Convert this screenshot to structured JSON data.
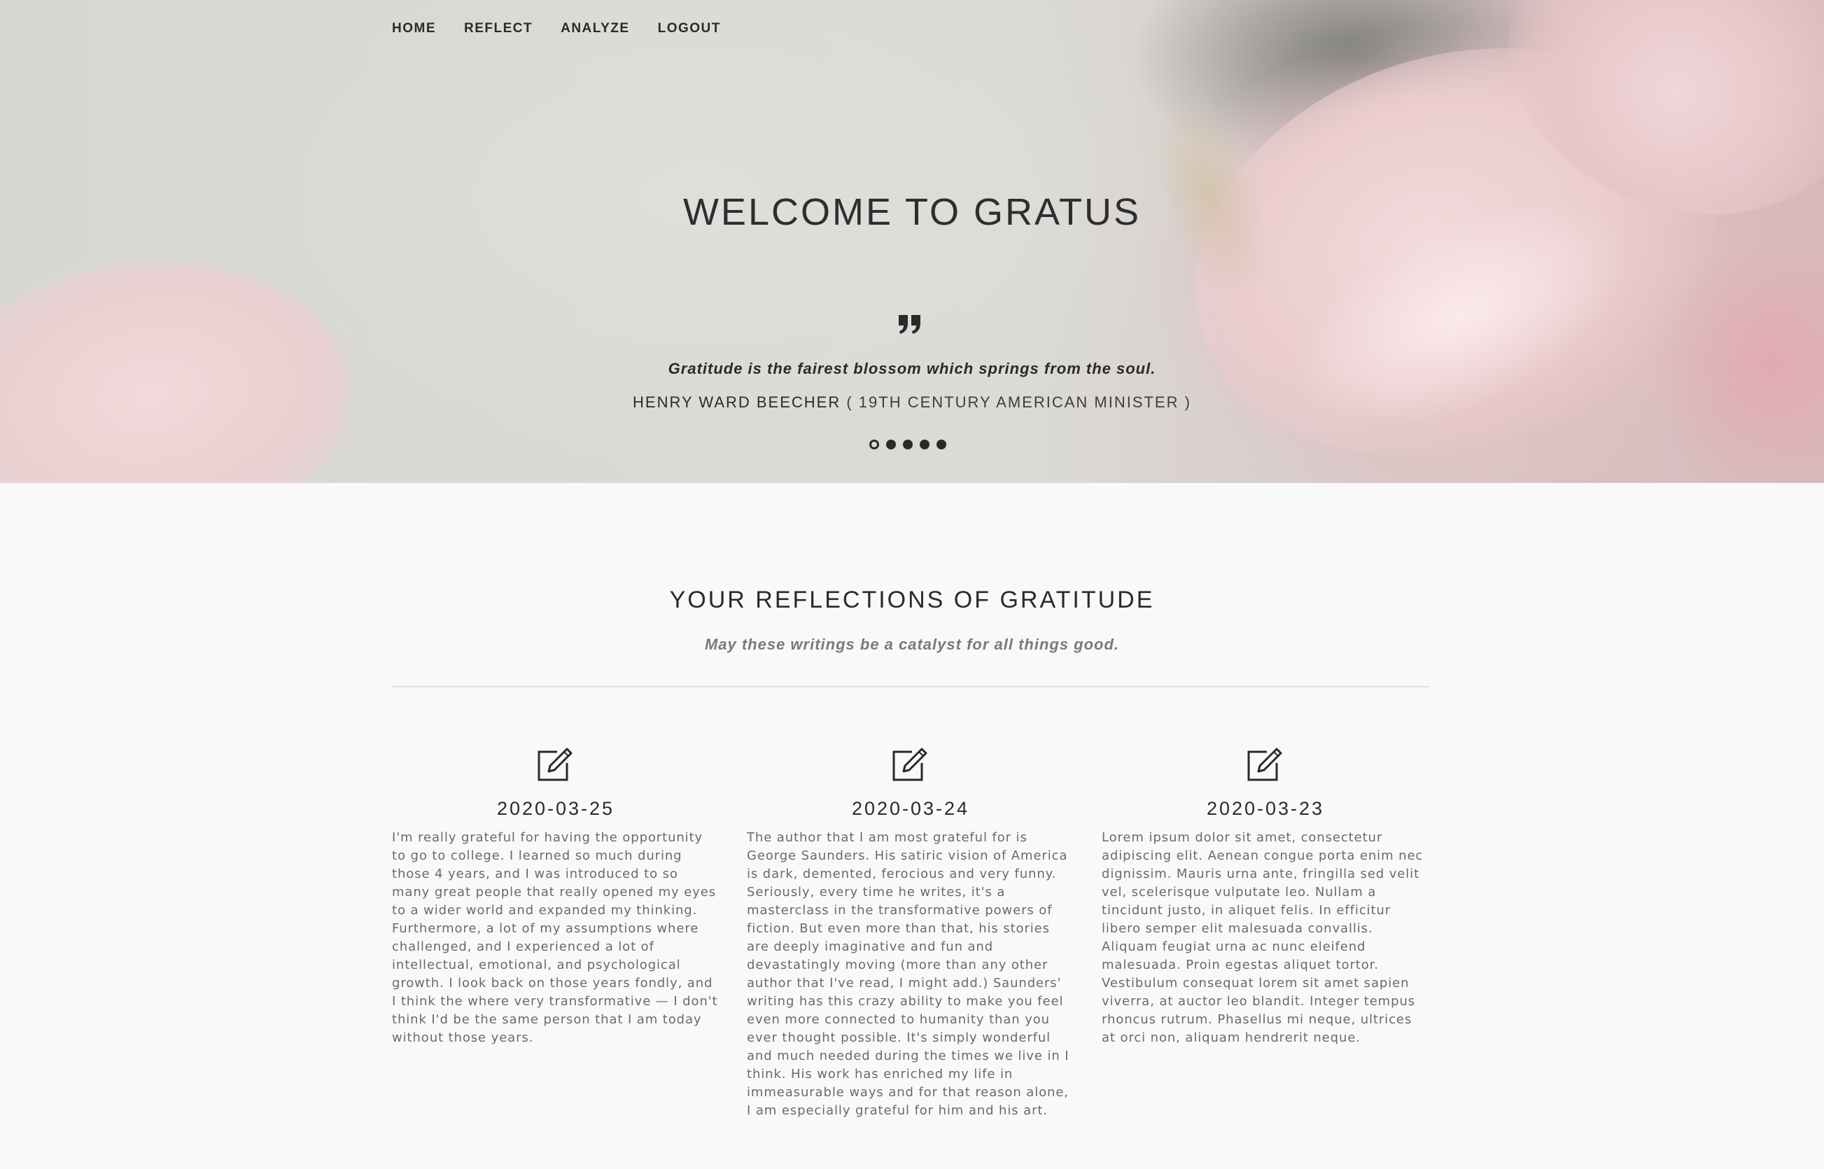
{
  "nav": {
    "items": [
      {
        "label": "HOME"
      },
      {
        "label": "REFLECT"
      },
      {
        "label": "ANALYZE"
      },
      {
        "label": "LOGOUT"
      }
    ]
  },
  "hero": {
    "title": "WELCOME TO GRATUS",
    "quote_icon": "quote-icon",
    "quote": "Gratitude is the fairest blossom which springs from the soul.",
    "author": "HENRY WARD BEECHER",
    "author_role": " ( 19TH CENTURY AMERICAN MINISTER )",
    "slides_total": 5,
    "slide_active": 1
  },
  "section": {
    "title": "YOUR REFLECTIONS OF GRATITUDE",
    "subtitle": "May these writings be a catalyst for all things good."
  },
  "reflections": [
    {
      "icon": "edit-icon",
      "date": "2020-03-25",
      "text": "I'm really grateful for having the opportunity to go to college. I learned so much during those 4 years, and I was introduced to so many great people that really opened my eyes to a wider world and expanded my thinking. Furthermore, a lot of my assumptions where challenged, and I experienced a lot of intellectual, emotional, and psychological growth. I look back on those years fondly, and I think the where very transformative — I don't think I'd be the same person that I am today without those years."
    },
    {
      "icon": "edit-icon",
      "date": "2020-03-24",
      "text": "The author that I am most grateful for is George Saunders. His satiric vision of America is dark, demented, ferocious and very funny. Seriously, every time he writes, it's a masterclass in the transformative powers of fiction. But even more than that, his stories are deeply imaginative and fun and devastatingly moving (more than any other author that I've read, I might add.) Saunders' writing has this crazy ability to make you feel even more connected to humanity than you ever thought possible. It's simply wonderful and much needed during the times we live in I think. His work has enriched my life in immeasurable ways and for that reason alone, I am especially grateful for him and his art."
    },
    {
      "icon": "edit-icon",
      "date": "2020-03-23",
      "text": "Lorem ipsum dolor sit amet, consectetur adipiscing elit. Aenean congue porta enim nec dignissim. Mauris urna ante, fringilla sed velit vel, scelerisque vulputate leo. Nullam a tincidunt justo, in aliquet felis. In efficitur libero semper elit malesuada convallis. Aliquam feugiat urna ac nunc eleifend malesuada. Proin egestas aliquet tortor. Vestibulum consequat lorem sit amet sapien viverra, at auctor leo blandit. Integer tempus rhoncus rutrum. Phasellus mi neque, ultrices at orci non, aliquam hendrerit neque."
    }
  ]
}
